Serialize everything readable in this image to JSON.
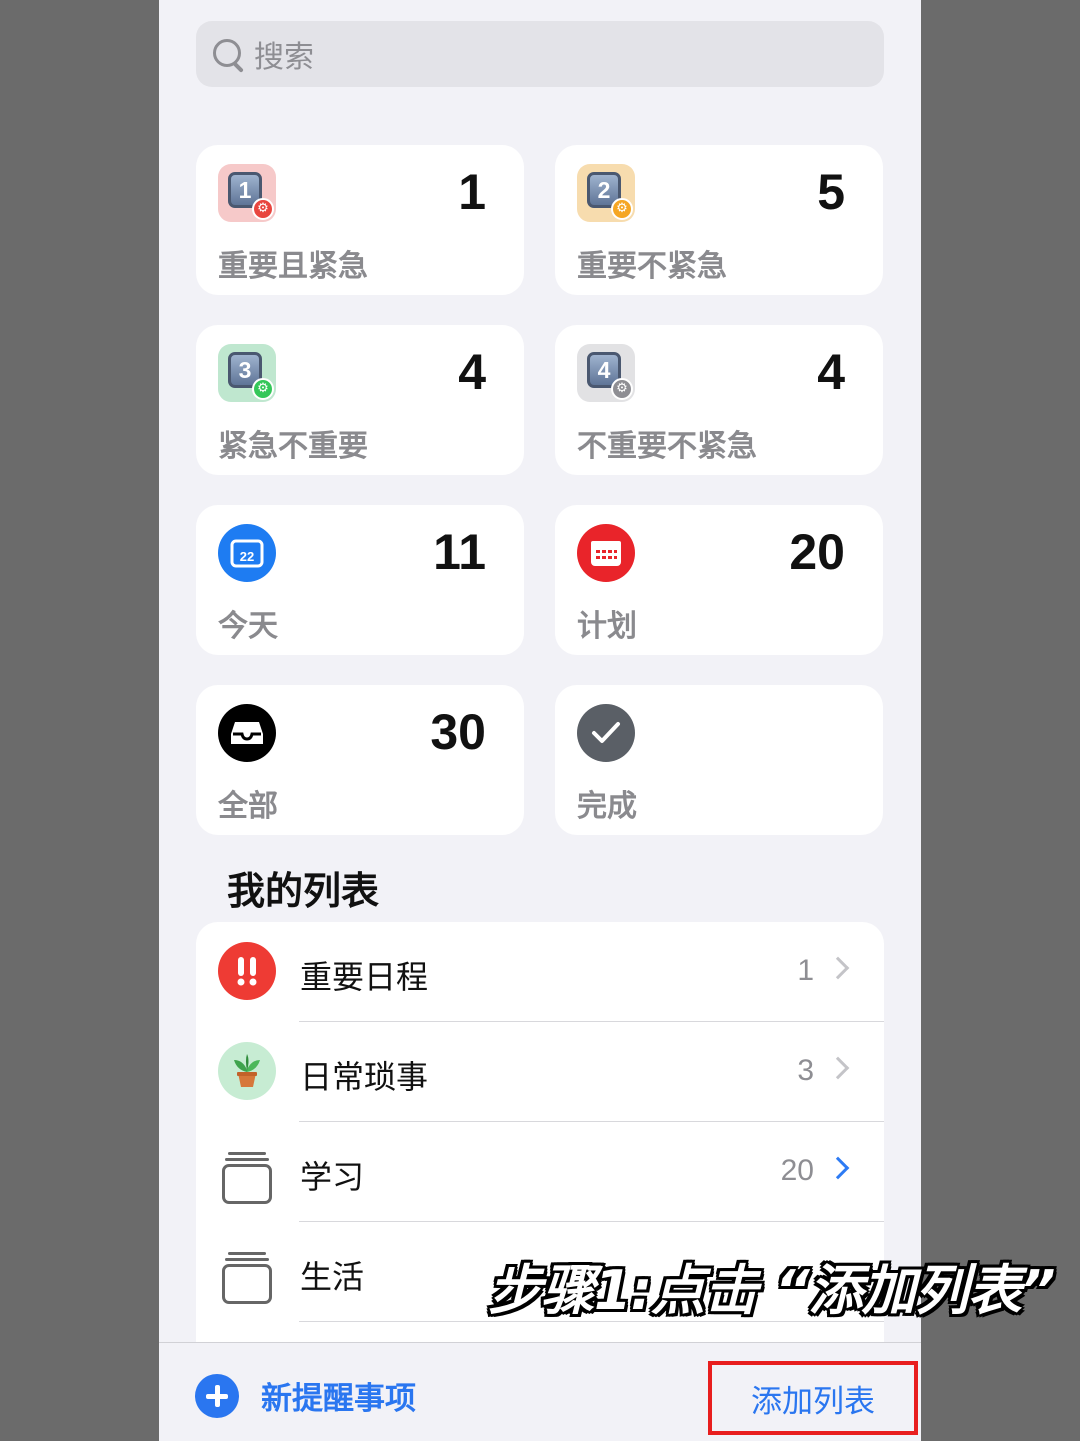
{
  "search": {
    "placeholder": "搜索"
  },
  "cards": [
    {
      "label": "重要且紧急",
      "count": "1",
      "icon": "priority-1-icon",
      "tile_number": "1",
      "tile_color": "#f6c9c9",
      "badge_color": "#e8463f"
    },
    {
      "label": "重要不紧急",
      "count": "5",
      "icon": "priority-2-icon",
      "tile_number": "2",
      "tile_color": "#f7dcae",
      "badge_color": "#f5a623"
    },
    {
      "label": "紧急不重要",
      "count": "4",
      "icon": "priority-3-icon",
      "tile_number": "3",
      "tile_color": "#bfe7cf",
      "badge_color": "#34c759"
    },
    {
      "label": "不重要不紧急",
      "count": "4",
      "icon": "priority-4-icon",
      "tile_number": "4",
      "tile_color": "#e2e2e4",
      "badge_color": "#8e8e93"
    },
    {
      "label": "今天",
      "count": "11",
      "icon": "calendar-today-icon",
      "icon_text": "22",
      "color": "#1e7cf2"
    },
    {
      "label": "计划",
      "count": "20",
      "icon": "calendar-scheduled-icon",
      "color": "#e9242a"
    },
    {
      "label": "全部",
      "count": "30",
      "icon": "inbox-tray-icon",
      "color": "#000000"
    },
    {
      "label": "完成",
      "count": "",
      "icon": "checkmark-icon",
      "color": "#5a5f66"
    }
  ],
  "my_lists": {
    "title": "我的列表",
    "items": [
      {
        "label": "重要日程",
        "count": "1",
        "icon": "exclamation-icon",
        "color": "#ee3b34"
      },
      {
        "label": "日常琐事",
        "count": "3",
        "icon": "potted-plant-icon",
        "color": "#c7ecd3"
      },
      {
        "label": "学习",
        "count": "20",
        "icon": "stack-folder-icon"
      },
      {
        "label": "生活",
        "count": "",
        "icon": "stack-folder-icon"
      }
    ]
  },
  "toolbar": {
    "new_reminder": "新提醒事项",
    "add_list": "添加列表"
  },
  "overlay": {
    "instruction": "步骤1:点击 “添加列表”"
  },
  "colors": {
    "accent": "#2a76f0",
    "highlight_box": "#e81e1e"
  }
}
